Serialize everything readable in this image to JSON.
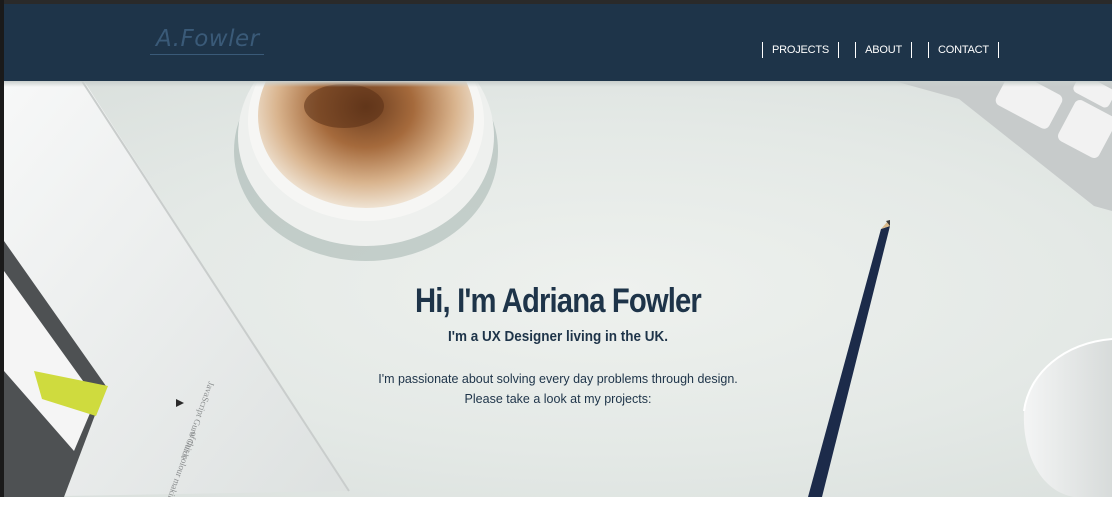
{
  "header": {
    "logo_text": "A.Fowler",
    "nav": [
      {
        "label": "PROJECTS"
      },
      {
        "label": "ABOUT"
      },
      {
        "label": "CONTACT"
      }
    ]
  },
  "hero": {
    "title": "Hi, I'm Adriana Fowler",
    "subtitle": "I'm a UX Designer living in the UK.",
    "description_line1": "I'm passionate about solving every day problems through design.",
    "description_line2": "Please take a look at my projects:"
  },
  "colors": {
    "navbar": "#1e3449",
    "text_dark": "#1e3449",
    "nav_text": "#ffffff"
  }
}
